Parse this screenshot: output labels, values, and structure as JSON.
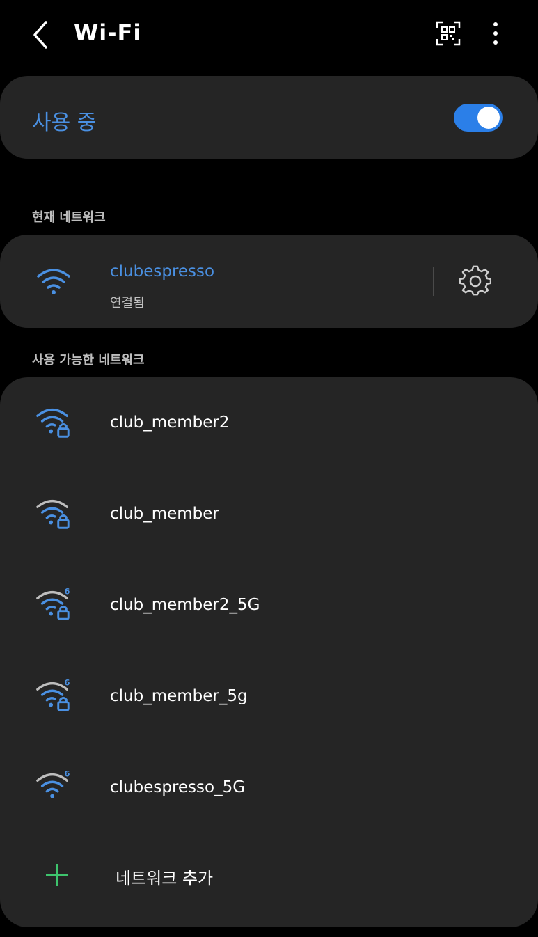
{
  "header": {
    "title": "Wi-Fi",
    "back_icon": "chevron-left-icon",
    "qr_icon": "qr-code-icon",
    "more_icon": "more-vertical-icon"
  },
  "toggle": {
    "label": "사용 중",
    "on": true,
    "accent": "#2b7fe8"
  },
  "current_section": {
    "label": "현재 네트워크",
    "network": {
      "name": "clubespresso",
      "status": "연결됨",
      "icon": "wifi-icon",
      "settings_icon": "gear-icon"
    }
  },
  "available_section": {
    "label": "사용 가능한 네트워크",
    "networks": [
      {
        "name": "club_member2",
        "locked": true,
        "wifi6": false,
        "signal": 3
      },
      {
        "name": "club_member",
        "locked": true,
        "wifi6": false,
        "signal": 2
      },
      {
        "name": "club_member2_5G",
        "locked": true,
        "wifi6": true,
        "signal": 2
      },
      {
        "name": "club_member_5g",
        "locked": true,
        "wifi6": true,
        "signal": 2
      },
      {
        "name": "clubespresso_5G",
        "locked": false,
        "wifi6": true,
        "signal": 2
      }
    ],
    "add_label": "네트워크 추가",
    "add_icon": "plus-icon"
  },
  "colors": {
    "background": "#000000",
    "card": "#252525",
    "accent_text": "#4a90e2",
    "wifi_blue": "#4a90e2",
    "wifi_dim": "#bdbdbd",
    "add_green": "#3ec46d"
  }
}
